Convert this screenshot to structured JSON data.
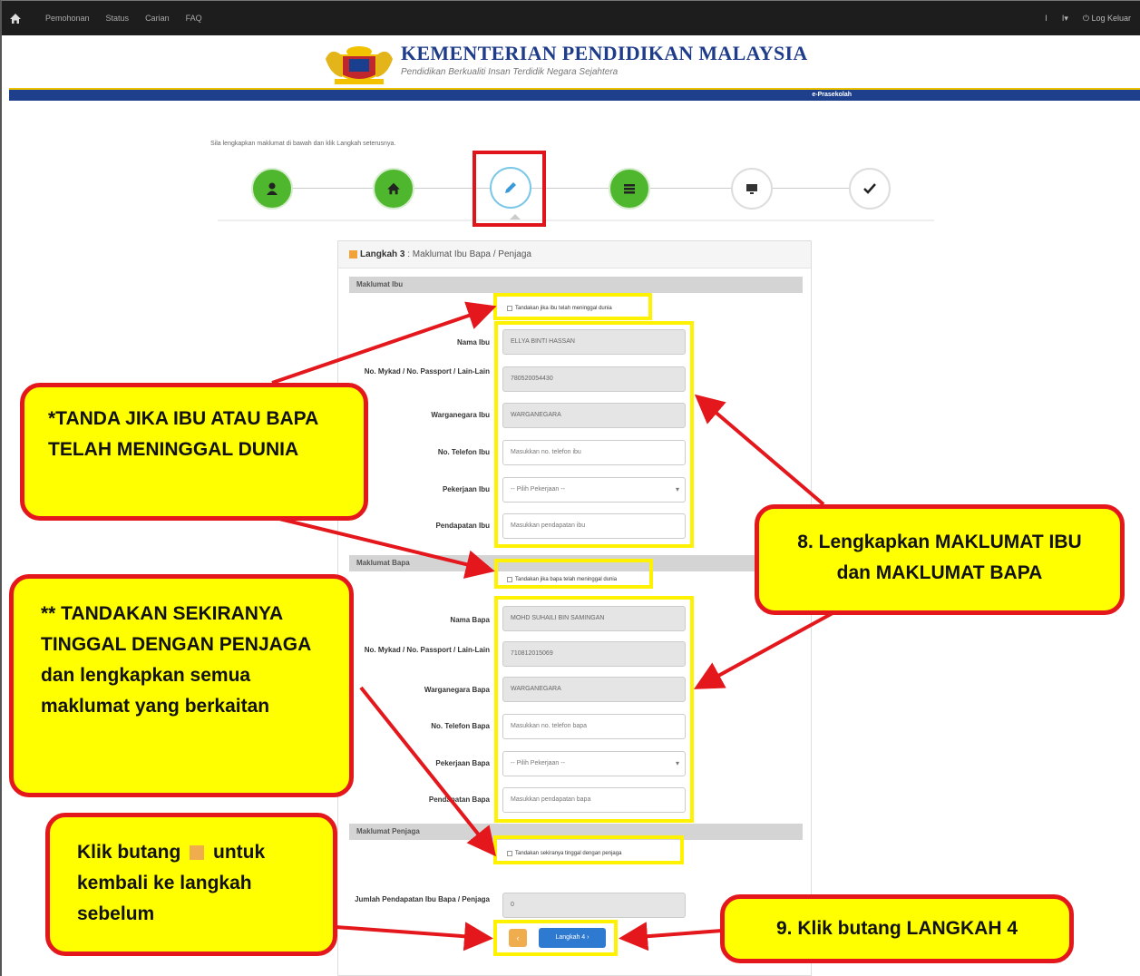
{
  "navbar": {
    "links": [
      "Pemohonan",
      "Status",
      "Carian",
      "FAQ"
    ],
    "right_items": [
      "I",
      "I▾",
      "⏻ Log Keluar"
    ]
  },
  "header": {
    "ministry_name": "KEMENTERIAN PENDIDIKAN MALAYSIA",
    "tagline": "Pendidikan Berkualiti Insan Terdidik Negara Sejahtera",
    "bar_label": "e-Prasekolah"
  },
  "instruction": "Sila lengkapkan maklumat di bawah dan klik Langkah seterusnya.",
  "steps": [
    {
      "icon": "user-icon",
      "status": "done"
    },
    {
      "icon": "home-icon",
      "status": "done"
    },
    {
      "icon": "pencil-icon",
      "status": "current"
    },
    {
      "icon": "list-icon",
      "status": "done"
    },
    {
      "icon": "monitor-icon",
      "status": "todo"
    },
    {
      "icon": "check-icon",
      "status": "todo"
    }
  ],
  "form": {
    "title_prefix": "Langkah 3",
    "title_rest": " : Maklumat Ibu Bapa / Penjaga",
    "ibu": {
      "section": "Maklumat Ibu",
      "checkbox": "Tandakan jika ibu telah meninggal dunia",
      "fields": [
        {
          "label": "Nama Ibu",
          "value": "ELLYA BINTI HASSAN",
          "readonly": true
        },
        {
          "label": "No. Mykad / No. Passport / Lain-Lain",
          "value": "780520054430",
          "readonly": true
        },
        {
          "label": "Warganegara Ibu",
          "value": "WARGANEGARA",
          "readonly": true
        },
        {
          "label": "No. Telefon Ibu",
          "value": "Masukkan no. telefon ibu",
          "readonly": false
        },
        {
          "label": "Pekerjaan Ibu",
          "value": "-- Pilih Pekerjaan --",
          "readonly": false,
          "select": true
        },
        {
          "label": "Pendapatan Ibu",
          "value": "Masukkan pendapatan ibu",
          "readonly": false
        }
      ]
    },
    "bapa": {
      "section": "Maklumat Bapa",
      "checkbox": "Tandakan jika bapa telah meninggal dunia",
      "fields": [
        {
          "label": "Nama Bapa",
          "value": "MOHD SUHAILI BIN SAMINGAN",
          "readonly": true
        },
        {
          "label": "No. Mykad / No. Passport / Lain-Lain",
          "value": "710812015069",
          "readonly": true
        },
        {
          "label": "Warganegara Bapa",
          "value": "WARGANEGARA",
          "readonly": true
        },
        {
          "label": "No. Telefon Bapa",
          "value": "Masukkan no. telefon bapa",
          "readonly": false
        },
        {
          "label": "Pekerjaan Bapa",
          "value": "-- Pilih Pekerjaan --",
          "readonly": false,
          "select": true
        },
        {
          "label": "Pendapatan Bapa",
          "value": "Masukkan pendapatan bapa",
          "readonly": false
        }
      ]
    },
    "penjaga": {
      "section": "Maklumat Penjaga",
      "checkbox": "Tandakan sekiranya tinggal dengan penjaga"
    },
    "jumlah_label": "Jumlah Pendapatan Ibu Bapa / Penjaga",
    "jumlah_value": "0",
    "back_label": "‹",
    "next_label": "Langkah 4 ›"
  },
  "callouts": {
    "tanda_meninggal": "*TANDA JIKA IBU ATAU BAPA TELAH MENINGGAL DUNIA",
    "lengkapkan": "8. Lengkapkan MAKLUMAT IBU dan MAKLUMAT BAPA",
    "penjaga": "** TANDAKAN SEKIRANYA TINGGAL DENGAN PENJAGA dan lengkapkan semua maklumat yang berkaitan",
    "klik_before": "Klik butang ",
    "klik_after": " untuk kembali ke langkah sebelum",
    "langkah4": "9. Klik butang LANGKAH 4"
  },
  "colors": {
    "callout_bg": "#ffff00",
    "callout_border": "#e3171c",
    "highlight_yellow": "#fff200",
    "step_done": "#4fb72e",
    "ministry_blue": "#1f3c8a"
  }
}
